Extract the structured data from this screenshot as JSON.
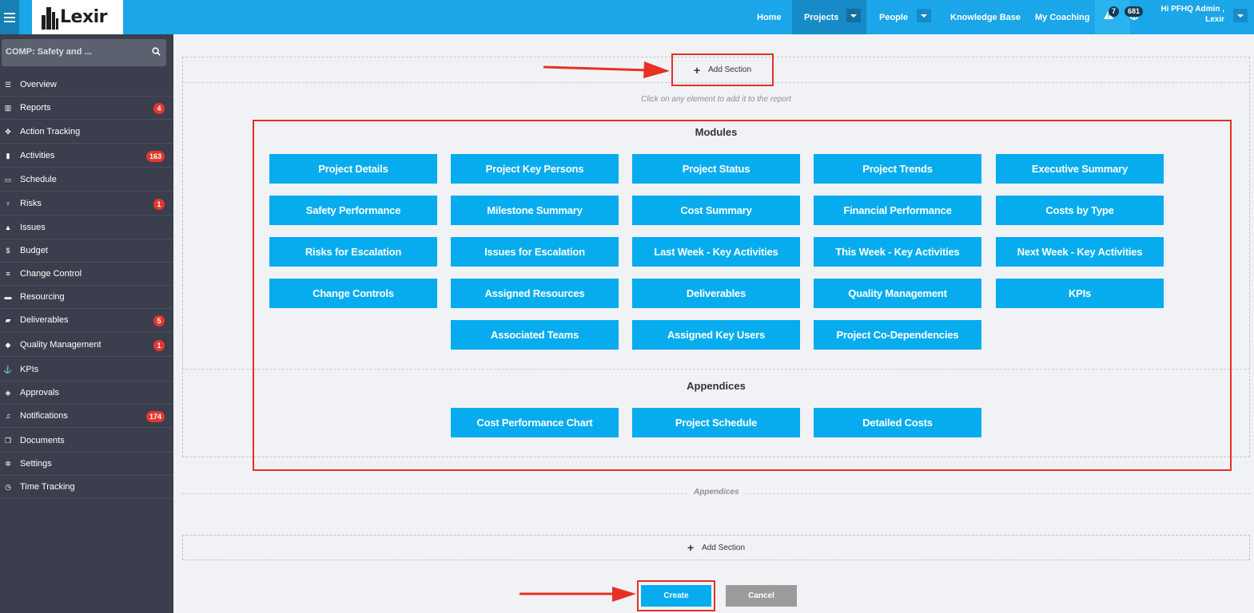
{
  "app": {
    "logo_text": "Lexir"
  },
  "topnav": {
    "home": "Home",
    "projects": "Projects",
    "people": "People",
    "knowledge_base": "Knowledge Base",
    "my_coaching": "My Coaching",
    "alerts_count": "7",
    "notifications_count": "681",
    "user_line1": "Hi PFHQ Admin ,",
    "user_line2": "Lexir"
  },
  "sidebar": {
    "search_value": "COMP: Safety and ...",
    "items": [
      {
        "label": "Overview",
        "icon": "list-icon",
        "badge": ""
      },
      {
        "label": "Reports",
        "icon": "bar-chart-icon",
        "badge": "4"
      },
      {
        "label": "Action Tracking",
        "icon": "crosshair-icon",
        "badge": ""
      },
      {
        "label": "Activities",
        "icon": "bookmark-icon",
        "badge": "163"
      },
      {
        "label": "Schedule",
        "icon": "calendar-icon",
        "badge": ""
      },
      {
        "label": "Risks",
        "icon": "lightbulb-icon",
        "badge": "1"
      },
      {
        "label": "Issues",
        "icon": "warning-icon",
        "badge": ""
      },
      {
        "label": "Budget",
        "icon": "dollar-icon",
        "badge": ""
      },
      {
        "label": "Change Control",
        "icon": "tasks-icon",
        "badge": ""
      },
      {
        "label": "Resourcing",
        "icon": "folder-icon",
        "badge": ""
      },
      {
        "label": "Deliverables",
        "icon": "truck-icon",
        "badge": "5"
      },
      {
        "label": "Quality Management",
        "icon": "tag-icon",
        "badge": "1"
      },
      {
        "label": "KPIs",
        "icon": "anchor-icon",
        "badge": ""
      },
      {
        "label": "Approvals",
        "icon": "ticket-icon",
        "badge": ""
      },
      {
        "label": "Notifications",
        "icon": "bell-icon",
        "badge": "174"
      },
      {
        "label": "Documents",
        "icon": "copy-icon",
        "badge": ""
      },
      {
        "label": "Settings",
        "icon": "cogs-icon",
        "badge": ""
      },
      {
        "label": "Time Tracking",
        "icon": "clock-icon",
        "badge": ""
      }
    ]
  },
  "main": {
    "add_section": "Add Section",
    "hint": "Click on any element to add it to the report",
    "modules_title": "Modules",
    "modules": [
      "Project Details",
      "Project Key Persons",
      "Project Status",
      "Project Trends",
      "Executive Summary",
      "Safety Performance",
      "Milestone Summary",
      "Cost Summary",
      "Financial Performance",
      "Costs by Type",
      "Risks for Escalation",
      "Issues for Escalation",
      "Last Week - Key Activities",
      "This Week - Key Activities",
      "Next Week - Key Activities",
      "Change Controls",
      "Assigned Resources",
      "Deliverables",
      "Quality Management",
      "KPIs",
      "Associated Teams",
      "Assigned Key Users",
      "Project Co-Dependencies"
    ],
    "appendices_title": "Appendices",
    "appendices": [
      "Cost Performance Chart",
      "Project Schedule",
      "Detailed Costs"
    ],
    "appendices_divider": "Appendices",
    "create": "Create",
    "cancel": "Cancel"
  },
  "colors": {
    "topbar": "#1aa6e8",
    "module_button": "#07acef",
    "sidebar": "#3b3f4d",
    "highlight": "#e53222",
    "cancel": "#9b9b9b"
  }
}
